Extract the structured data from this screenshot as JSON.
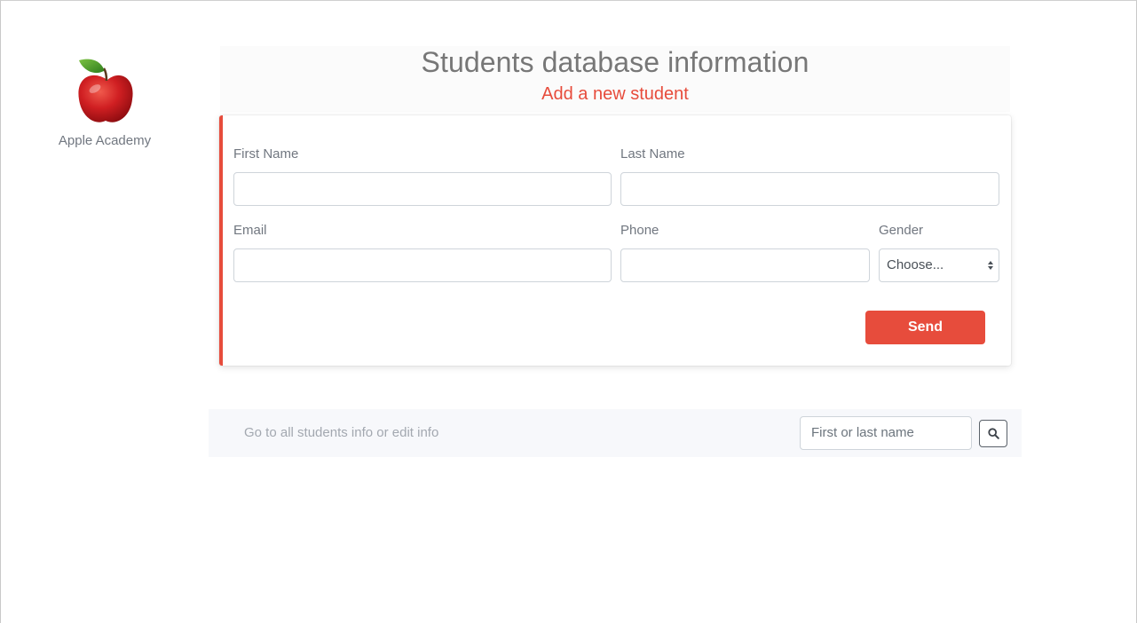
{
  "brand": {
    "name": "Apple Academy",
    "logo_icon": "apple-logo"
  },
  "header": {
    "title": "Students database information",
    "subtitle": "Add a new student"
  },
  "form": {
    "first_name": {
      "label": "First Name",
      "value": ""
    },
    "last_name": {
      "label": "Last Name",
      "value": ""
    },
    "email": {
      "label": "Email",
      "value": ""
    },
    "phone": {
      "label": "Phone",
      "value": ""
    },
    "gender": {
      "label": "Gender",
      "selected": "Choose..."
    },
    "send_label": "Send"
  },
  "search": {
    "link_text": "Go to all students info or edit info",
    "placeholder": "First or last name",
    "button_icon": "search-icon"
  },
  "colors": {
    "accent": "#e74c3c",
    "muted_text": "#717780",
    "bar_background": "#f7f8fb"
  }
}
